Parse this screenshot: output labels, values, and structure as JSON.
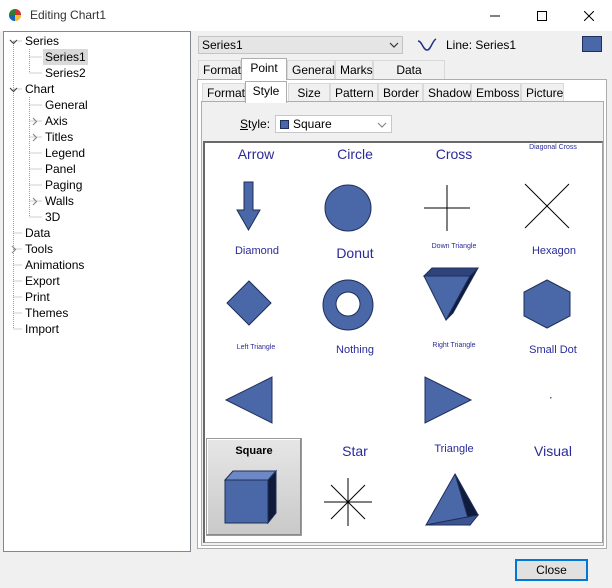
{
  "window": {
    "title": "Editing Chart1"
  },
  "tree": {
    "items": [
      {
        "label": "Series"
      },
      {
        "label": "Series1"
      },
      {
        "label": "Series2"
      },
      {
        "label": "Chart"
      },
      {
        "label": "General"
      },
      {
        "label": "Axis"
      },
      {
        "label": "Titles"
      },
      {
        "label": "Legend"
      },
      {
        "label": "Panel"
      },
      {
        "label": "Paging"
      },
      {
        "label": "Walls"
      },
      {
        "label": "3D"
      },
      {
        "label": "Data"
      },
      {
        "label": "Tools"
      },
      {
        "label": "Animations"
      },
      {
        "label": "Export"
      },
      {
        "label": "Print"
      },
      {
        "label": "Themes"
      },
      {
        "label": "Import"
      }
    ]
  },
  "series_selector": {
    "value": "Series1",
    "line_label": "Line: Series1",
    "color": "#4a67a8"
  },
  "tabs_main": [
    {
      "label": "Format"
    },
    {
      "label": "Point"
    },
    {
      "label": "General"
    },
    {
      "label": "Marks"
    },
    {
      "label": "Data Source"
    }
  ],
  "tabs_point": [
    {
      "label": "Format"
    },
    {
      "label": "Style"
    },
    {
      "label": "Size"
    },
    {
      "label": "Pattern"
    },
    {
      "label": "Border"
    },
    {
      "label": "Shadow"
    },
    {
      "label": "Emboss"
    },
    {
      "label": "Picture"
    }
  ],
  "style": {
    "label_prefix": "S",
    "label_rest": "tyle:",
    "value": "Square"
  },
  "pointers": [
    {
      "label": "Arrow"
    },
    {
      "label": "Circle"
    },
    {
      "label": "Cross"
    },
    {
      "label": "Diagonal Cross"
    },
    {
      "label": "Diamond"
    },
    {
      "label": "Donut"
    },
    {
      "label": "Down Triangle"
    },
    {
      "label": "Hexagon"
    },
    {
      "label": "Left Triangle"
    },
    {
      "label": "Nothing"
    },
    {
      "label": "Right Triangle"
    },
    {
      "label": "Small Dot"
    },
    {
      "label": "Square"
    },
    {
      "label": "Star"
    },
    {
      "label": "Triangle"
    },
    {
      "label": "Visual"
    }
  ],
  "footer": {
    "close_label": "Close"
  },
  "colors": {
    "shape_fill": "#4a67a8",
    "shape_stroke": "#1d2f5a",
    "label_text": "#2a2a9a"
  }
}
